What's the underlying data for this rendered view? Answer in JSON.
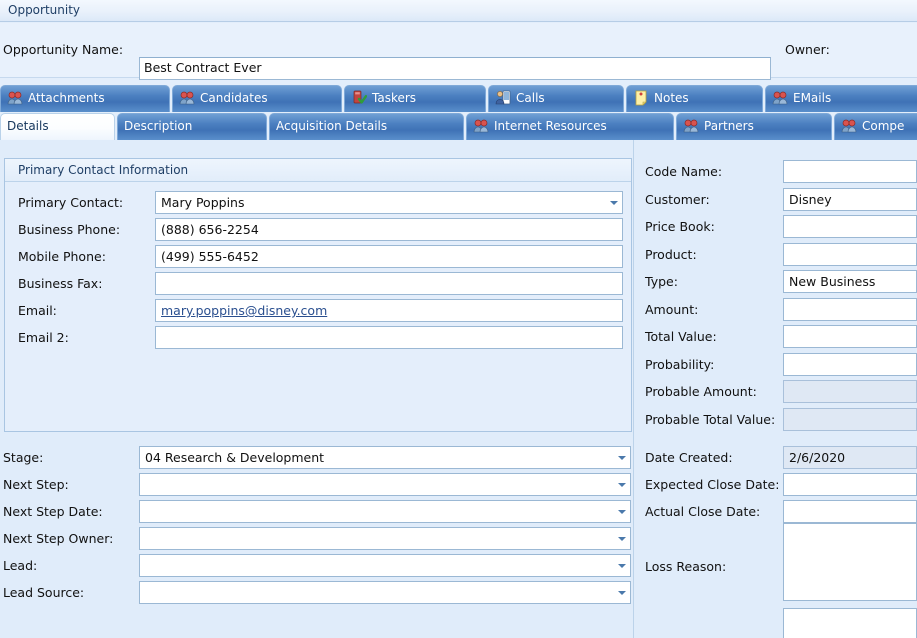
{
  "window": {
    "title": "Opportunity"
  },
  "header": {
    "opportunity_name_label": "Opportunity Name:",
    "opportunity_name_value": "Best Contract Ever",
    "owner_label": "Owner:",
    "owner_value": ""
  },
  "tabs_top": [
    {
      "label": "Attachments",
      "icon": "people-icon",
      "active": false
    },
    {
      "label": "Candidates",
      "icon": "people-icon",
      "active": false
    },
    {
      "label": "Taskers",
      "icon": "task-icon",
      "active": false
    },
    {
      "label": "Calls",
      "icon": "call-icon",
      "active": false
    },
    {
      "label": "Notes",
      "icon": "note-icon",
      "active": false
    },
    {
      "label": "EMails",
      "icon": "people-icon",
      "active": false
    }
  ],
  "tabs_bottom": [
    {
      "label": "Details",
      "icon": "",
      "active": true
    },
    {
      "label": "Description",
      "icon": "",
      "active": false
    },
    {
      "label": "Acquisition Details",
      "icon": "",
      "active": false
    },
    {
      "label": "Internet Resources",
      "icon": "people-icon",
      "active": false
    },
    {
      "label": "Partners",
      "icon": "people-icon",
      "active": false
    },
    {
      "label": "Compe",
      "icon": "people-icon",
      "active": false
    }
  ],
  "primary_contact_panel": {
    "title": "Primary Contact Information",
    "fields": [
      {
        "label": "Primary Contact:",
        "value": "Mary Poppins",
        "type": "combo"
      },
      {
        "label": "Business Phone:",
        "value": "(888) 656-2254",
        "type": "text"
      },
      {
        "label": "Mobile Phone:",
        "value": "(499) 555-6452",
        "type": "text"
      },
      {
        "label": "Business Fax:",
        "value": "",
        "type": "text"
      },
      {
        "label": "Email:",
        "value": "mary.poppins@disney.com",
        "type": "link"
      },
      {
        "label": "Email 2:",
        "value": "",
        "type": "text"
      }
    ]
  },
  "right_fields": [
    {
      "label": "Code Name:",
      "value": "",
      "type": "text",
      "readonly": false
    },
    {
      "label": "Customer:",
      "value": "Disney",
      "type": "text",
      "readonly": false
    },
    {
      "label": "Price Book:",
      "value": "",
      "type": "text",
      "readonly": false
    },
    {
      "label": "Product:",
      "value": "",
      "type": "text",
      "readonly": false
    },
    {
      "label": "Type:",
      "value": "New Business",
      "type": "text",
      "readonly": false
    },
    {
      "label": "Amount:",
      "value": "",
      "type": "text",
      "readonly": false
    },
    {
      "label": "Total Value:",
      "value": "",
      "type": "text",
      "readonly": false
    },
    {
      "label": "Probability:",
      "value": "",
      "type": "text",
      "readonly": false
    },
    {
      "label": "Probable Amount:",
      "value": "",
      "type": "text",
      "readonly": true
    },
    {
      "label": "Probable Total Value:",
      "value": "",
      "type": "text",
      "readonly": true
    }
  ],
  "stage_fields": [
    {
      "label": "Stage:",
      "value": "04 Research & Development",
      "type": "combo"
    },
    {
      "label": "Next Step:",
      "value": "",
      "type": "combo"
    },
    {
      "label": "Next Step Date:",
      "value": "",
      "type": "combo"
    },
    {
      "label": "Next Step Owner:",
      "value": "",
      "type": "combo"
    },
    {
      "label": "Lead:",
      "value": "",
      "type": "combo"
    },
    {
      "label": "Lead Source:",
      "value": "",
      "type": "combo"
    }
  ],
  "date_fields": [
    {
      "label": "Date Created:",
      "value": "2/6/2020",
      "type": "text",
      "readonly": true
    },
    {
      "label": "Expected Close Date:",
      "value": "",
      "type": "text",
      "readonly": false
    },
    {
      "label": "Actual Close Date:",
      "value": "",
      "type": "text",
      "readonly": false
    }
  ],
  "loss_reason": {
    "label": "Loss Reason:",
    "value": ""
  },
  "extra_textarea": {
    "value": ""
  },
  "colors": {
    "page_background": "#e0ecfa",
    "tab_active_text": "#15365c",
    "tab_inactive_background": "#4b7fc0",
    "panel_border": "#a9c5e2",
    "link_text": "#2a4f8f",
    "title_text": "#1f3f66",
    "readonly_field_background": "#dfe8f4"
  }
}
